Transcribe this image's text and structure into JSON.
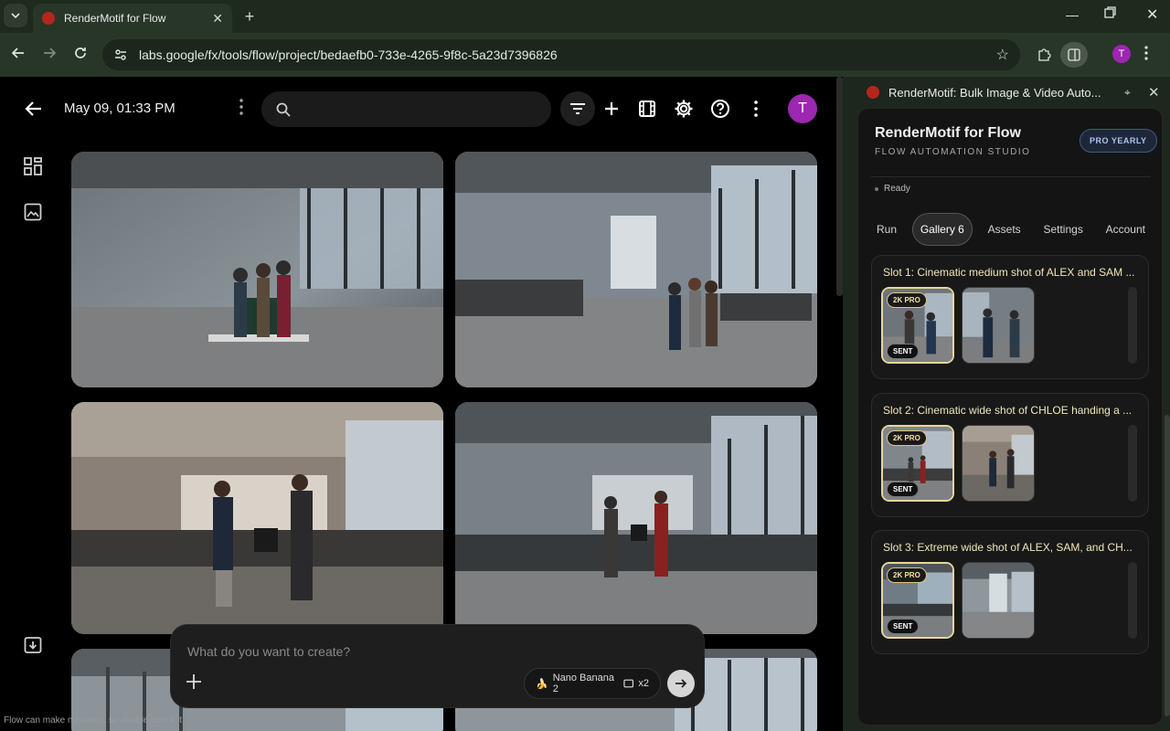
{
  "browser": {
    "tab_title": "RenderMotif for Flow",
    "url": "labs.google/fx/tools/flow/project/bedaefb0-733e-4265-9f8c-5a23d7396826",
    "profile_initial": "T"
  },
  "header": {
    "date": "May 09, 01:33 PM",
    "search_placeholder": "",
    "profile_initial": "T"
  },
  "composer": {
    "placeholder": "What do you want to create?",
    "model": "Nano Banana 2",
    "count": "x2"
  },
  "disclaimer": "Flow can make mistakes, so double check it",
  "extension": {
    "window_title": "RenderMotif: Bulk Image & Video Auto...",
    "brand": "RenderMotif for Flow",
    "subtitle": "FLOW AUTOMATION STUDIO",
    "plan_badge": "PRO YEARLY",
    "status": "Ready",
    "tabs": [
      "Run",
      "Gallery 6",
      "Assets",
      "Settings",
      "Account"
    ],
    "slots": [
      {
        "title": "Slot 1: Cinematic medium shot of ALEX and SAM ...",
        "quality": "2K PRO",
        "sent": "SENT"
      },
      {
        "title": "Slot 2: Cinematic wide shot of CHLOE handing a ...",
        "quality": "2K PRO",
        "sent": "SENT"
      },
      {
        "title": "Slot 3: Extreme wide shot of ALEX, SAM, and CH...",
        "quality": "2K PRO",
        "sent": "SENT"
      }
    ]
  },
  "colors": {
    "chrome_bg": "#1f2a1f",
    "accent_avatar": "#9c27b0",
    "badge_blue": "#a9c4f5",
    "pill_gold": "#f3e3a4"
  }
}
